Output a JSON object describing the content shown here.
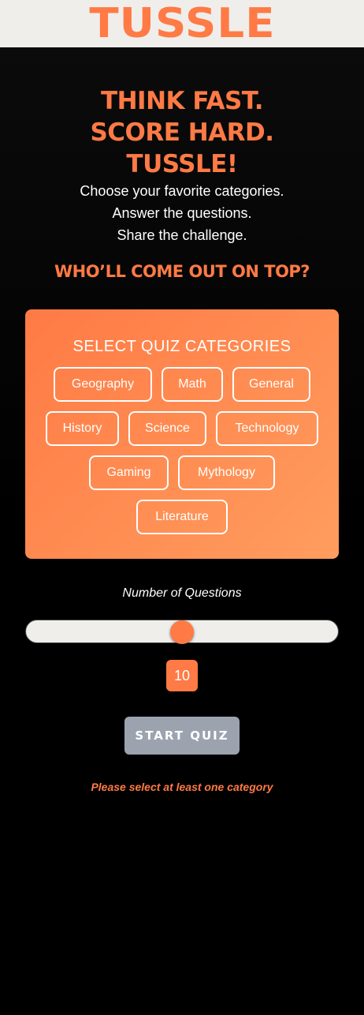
{
  "header": {
    "logo": "TUSSLE"
  },
  "hero": {
    "lines": [
      "THINK FAST.",
      "SCORE HARD.",
      "TUSSLE!"
    ],
    "subtitle_lines": [
      "Choose your favorite categories.",
      "Answer the questions.",
      "Share the challenge."
    ],
    "tagline": "WHO’LL COME OUT ON TOP?"
  },
  "categories": {
    "title": "SELECT QUIZ CATEGORIES",
    "items": [
      "Geography",
      "Math",
      "General",
      "History",
      "Science",
      "Technology",
      "Gaming",
      "Mythology",
      "Literature"
    ]
  },
  "questions": {
    "label": "Number of Questions",
    "value": "10",
    "slider_fraction": 0.5
  },
  "start_button": {
    "label": "START QUIZ"
  },
  "error": {
    "message": "Please select at least one category"
  },
  "colors": {
    "accent": "#ff7a45",
    "topbar_bg": "#efeeeb",
    "page_bg": "#000000",
    "button_disabled": "#9ca3af"
  }
}
